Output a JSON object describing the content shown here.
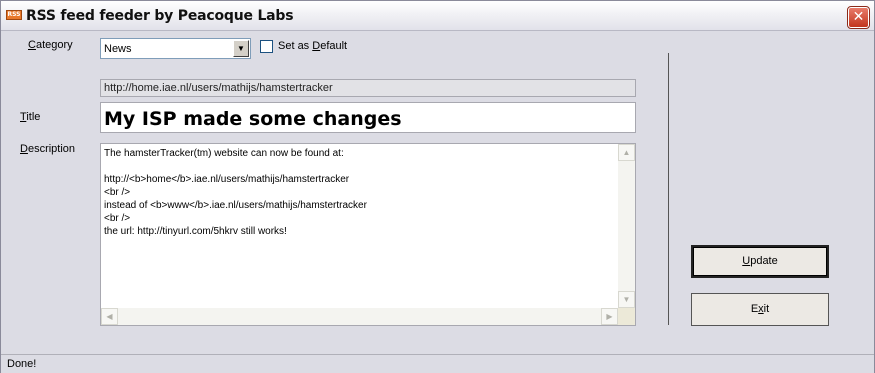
{
  "window": {
    "title": "RSS feed feeder by Peacoque Labs",
    "icon_text": "RSS",
    "close_glyph": "✕"
  },
  "form": {
    "category_label_key": "C",
    "category_label_rest": "ategory",
    "category_value": "News",
    "set_default_pre": "Set as ",
    "set_default_key": "D",
    "set_default_post": "efault",
    "set_default_checked": false,
    "url_value": "http://home.iae.nl/users/mathijs/hamstertracker",
    "title_label_key": "T",
    "title_label_rest": "itle",
    "title_value": "My ISP made some changes",
    "description_label_key": "D",
    "description_label_rest": "escription",
    "description_value": "The hamsterTracker(tm) website can now be found at:\n\nhttp://<b>home</b>.iae.nl/users/mathijs/hamstertracker\n<br />\ninstead of <b>www</b>.iae.nl/users/mathijs/hamstertracker\n<br />\nthe url: http://tinyurl.com/5hkrv still works!"
  },
  "buttons": {
    "update_key": "U",
    "update_rest": "pdate",
    "exit_pre": "E",
    "exit_key": "x",
    "exit_post": "it"
  },
  "status": {
    "text": "Done!"
  },
  "icons": {
    "dropdown": "chevron-down-icon",
    "close": "close-icon"
  }
}
